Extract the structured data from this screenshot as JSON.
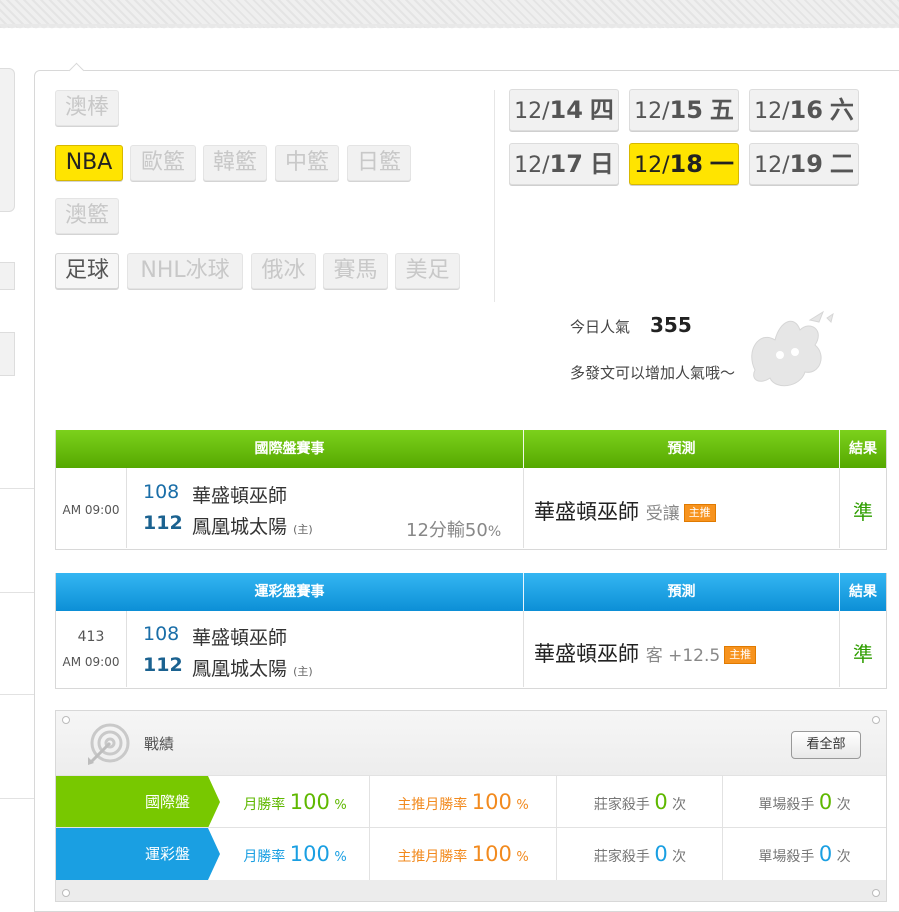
{
  "sports": {
    "row1": [
      {
        "label": "澳棒",
        "state": "disabled"
      }
    ],
    "row2": [
      {
        "label": "NBA",
        "state": "selected"
      },
      {
        "label": "歐籃",
        "state": "disabled"
      },
      {
        "label": "韓籃",
        "state": "disabled"
      },
      {
        "label": "中籃",
        "state": "disabled"
      },
      {
        "label": "日籃",
        "state": "disabled"
      }
    ],
    "row3": [
      {
        "label": "澳籃",
        "state": "disabled"
      }
    ],
    "row4": [
      {
        "label": "足球",
        "state": "active"
      },
      {
        "label": "NHL冰球",
        "state": "disabled"
      },
      {
        "label": "俄冰",
        "state": "disabled"
      },
      {
        "label": "賽馬",
        "state": "disabled"
      },
      {
        "label": "美足",
        "state": "disabled"
      }
    ]
  },
  "dates": [
    {
      "month": "12/",
      "day": "14",
      "weekday": "四",
      "selected": false
    },
    {
      "month": "12/",
      "day": "15",
      "weekday": "五",
      "selected": false
    },
    {
      "month": "12/",
      "day": "16",
      "weekday": "六",
      "selected": false
    },
    {
      "month": "12/",
      "day": "17",
      "weekday": "日",
      "selected": false
    },
    {
      "month": "12/",
      "day": "18",
      "weekday": "一",
      "selected": true
    },
    {
      "month": "12/",
      "day": "19",
      "weekday": "二",
      "selected": false
    }
  ],
  "popularity": {
    "label": "今日人氣",
    "value": "355",
    "sub": "多發文可以增加人氣哦～"
  },
  "international": {
    "headers": {
      "matches": "國際盤賽事",
      "prediction": "預測",
      "result": "結果"
    },
    "game": {
      "number": "",
      "time": "AM 09:00",
      "away_score": "108",
      "away_team": "華盛頓巫師",
      "home_score": "112",
      "home_team": "鳳凰城太陽",
      "home_mark": "(主)",
      "odds": "12分輸50",
      "odds_unit": "%",
      "pick_team": "華盛頓巫師",
      "pick_note": "受讓",
      "pick_tag": "主推",
      "result": "準"
    }
  },
  "lottery": {
    "headers": {
      "matches": "運彩盤賽事",
      "prediction": "預測",
      "result": "結果"
    },
    "game": {
      "number": "413",
      "time": "AM 09:00",
      "away_score": "108",
      "away_team": "華盛頓巫師",
      "home_score": "112",
      "home_team": "鳳凰城太陽",
      "home_mark": "(主)",
      "pick_team": "華盛頓巫師",
      "pick_note": "客 +12.5",
      "pick_tag": "主推",
      "result": "準"
    }
  },
  "stats": {
    "title": "戰績",
    "view_all": "看全部",
    "rows": [
      {
        "label": "國際盤",
        "month_win_label": "月勝率",
        "month_win_value": "100",
        "month_win_unit": "%",
        "main_win_label": "主推月勝率",
        "main_win_value": "100",
        "main_win_unit": "%",
        "banker_label": "莊家殺手",
        "banker_value": "0",
        "banker_unit": "次",
        "single_label": "單場殺手",
        "single_value": "0",
        "single_unit": "次"
      },
      {
        "label": "運彩盤",
        "month_win_label": "月勝率",
        "month_win_value": "100",
        "month_win_unit": "%",
        "main_win_label": "主推月勝率",
        "main_win_value": "100",
        "main_win_unit": "%",
        "banker_label": "莊家殺手",
        "banker_value": "0",
        "banker_unit": "次",
        "single_label": "單場殺手",
        "single_value": "0",
        "single_unit": "次"
      }
    ]
  }
}
